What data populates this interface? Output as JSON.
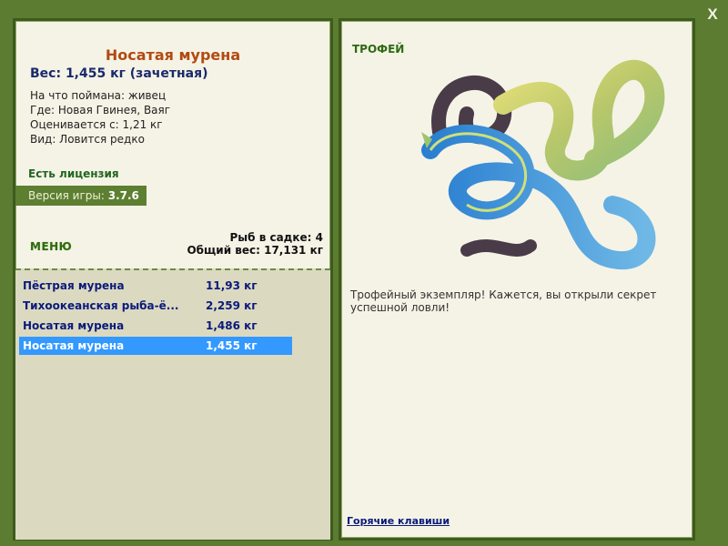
{
  "window": {
    "close_label": "X"
  },
  "fish": {
    "title": "Носатая мурена",
    "weight": "Вес: 1,455 кг (зачетная)",
    "bait": "На что поймана: живец",
    "location": "Где: Новая Гвинея, Ваяг",
    "rated_from": "Оценивается с: 1,21 кг",
    "rarity": "Вид: Ловится редко"
  },
  "license": "Есть лицензия",
  "version": {
    "label": "Версия игры:",
    "value": "3.7.6"
  },
  "menu_label": "МЕНЮ",
  "keepnet": {
    "count": "Рыб в садке: 4",
    "total_weight": "Общий вес: 17,131 кг"
  },
  "catches": [
    {
      "name": "Пёстрая мурена",
      "weight": "11,93 кг"
    },
    {
      "name": "Тихоокеанская рыба-ё...",
      "weight": "2,259 кг"
    },
    {
      "name": "Носатая мурена",
      "weight": "1,486 кг"
    },
    {
      "name": "Носатая мурена",
      "weight": "1,455 кг",
      "selected": true
    }
  ],
  "trophy": {
    "heading": "ТРОФЕЙ",
    "description": "Трофейный экземпляр! Кажется, вы открыли секрет успешной ловли!"
  },
  "hotkeys_link": "Горячие клавиши",
  "colors": {
    "selection": "#3399ff",
    "frame": "#5b7c31",
    "panel": "#f5f3e6",
    "title": "#b24a12"
  }
}
